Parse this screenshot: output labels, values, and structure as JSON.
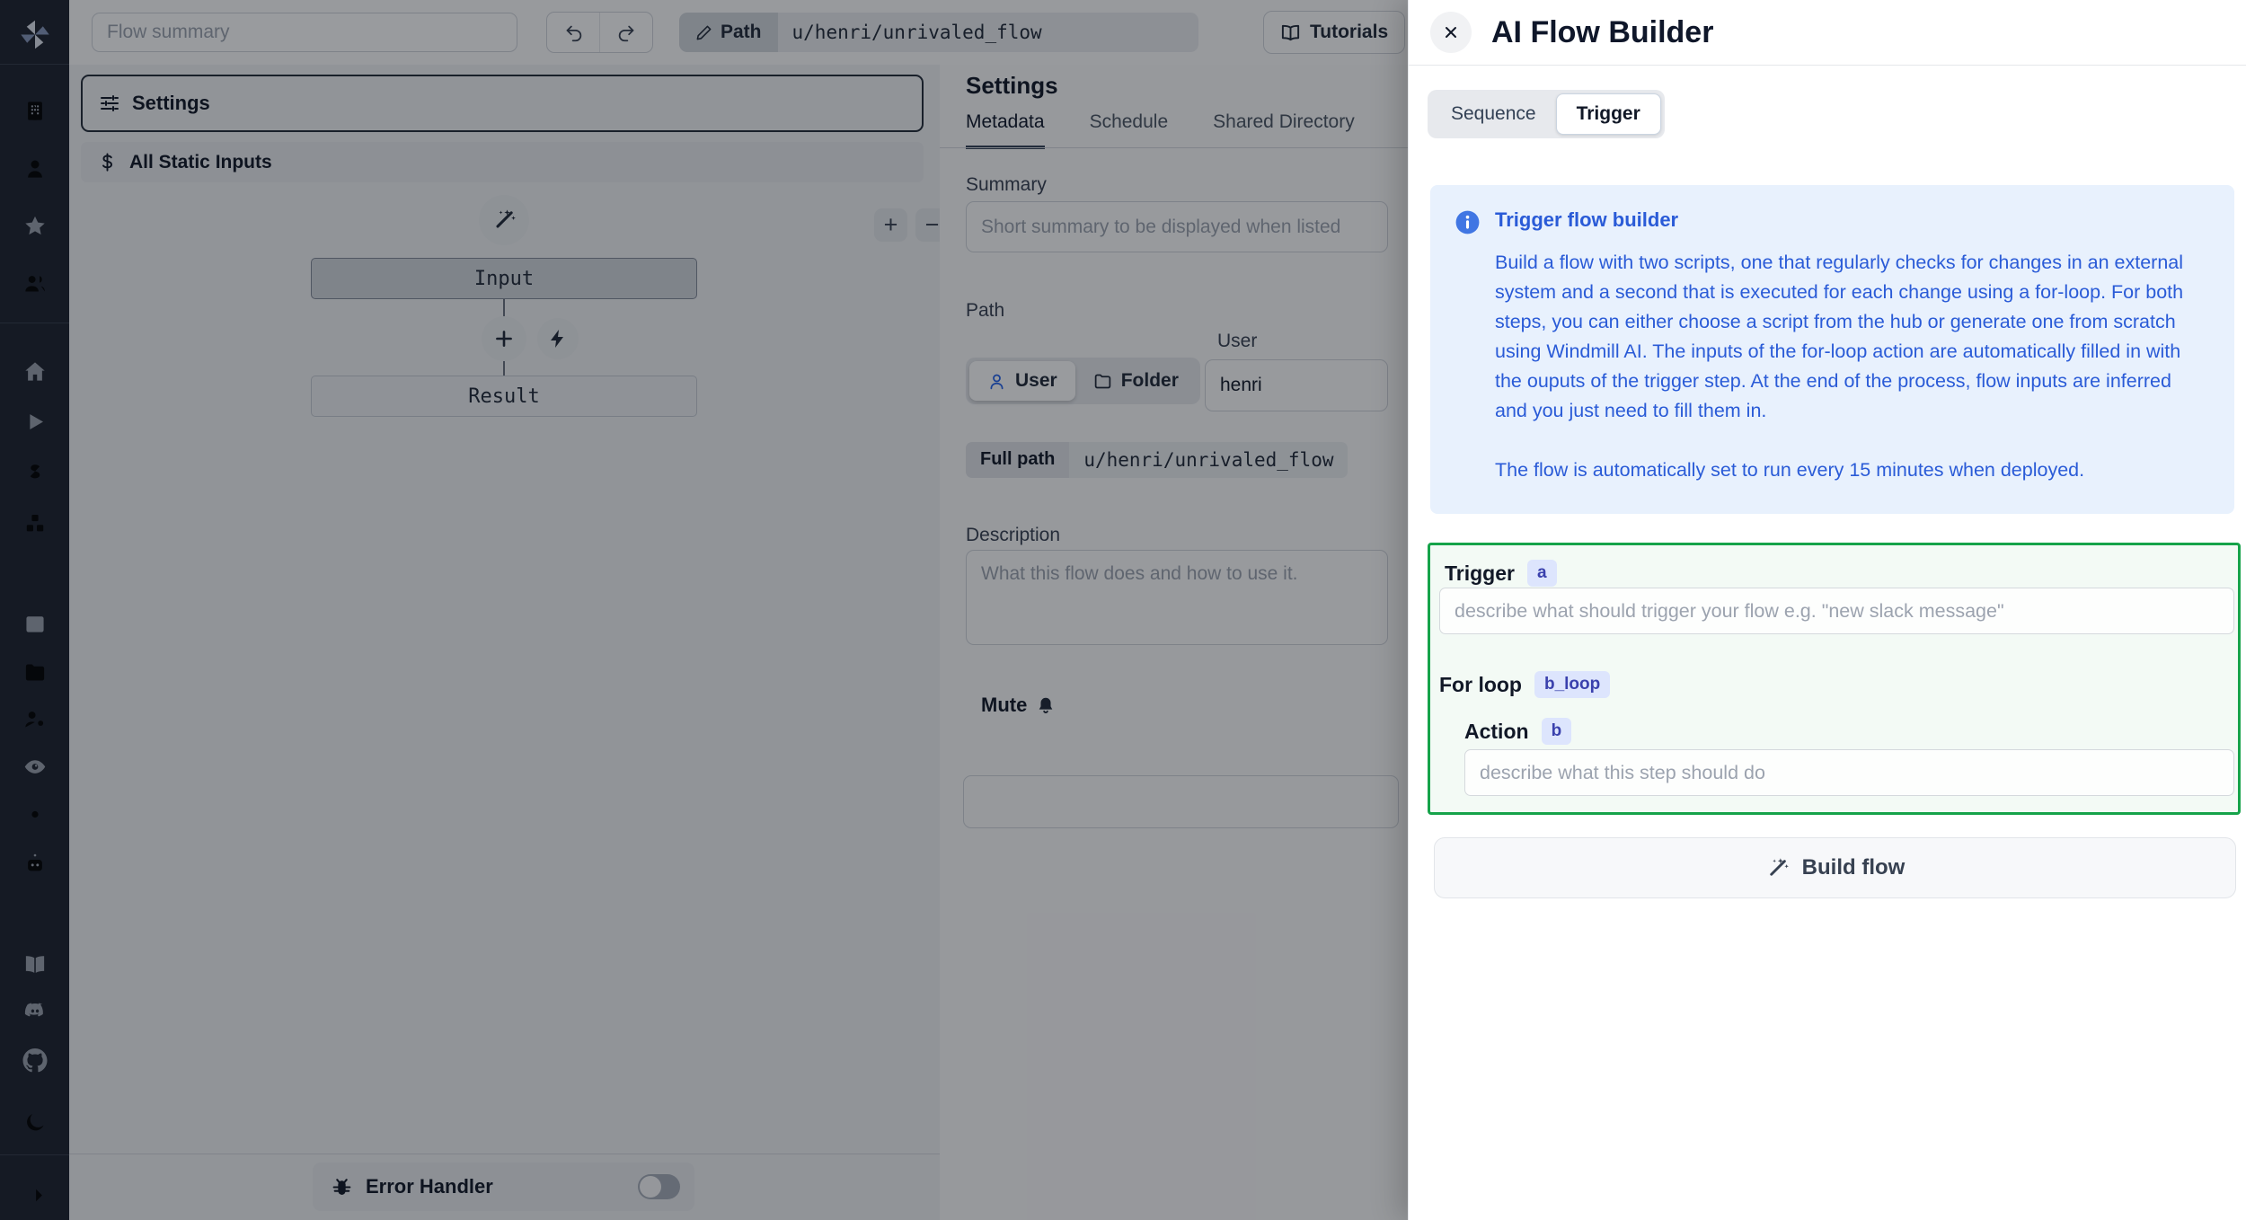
{
  "colors": {
    "accent_green": "#16a34a",
    "badge_bg": "#dde5fd",
    "badge_text": "#3a41ad",
    "info_blue": "#2a5bd7",
    "sidebar_bg": "#1d222d"
  },
  "sidebar": {
    "icons": [
      "windmill-logo",
      "building",
      "user",
      "star",
      "users",
      "home",
      "play",
      "dollar",
      "cubes",
      "calendar",
      "folder",
      "user-cog",
      "eye",
      "gear",
      "bot",
      "book",
      "discord",
      "github",
      "moon",
      "arrow-right"
    ]
  },
  "topbar": {
    "summary_placeholder": "Flow summary",
    "path_button": "Path",
    "path_value": "u/henri/unrivaled_flow",
    "tutorials": "Tutorials"
  },
  "flow_editor": {
    "settings_button": "Settings",
    "static_inputs_button": "All Static Inputs",
    "input_node": "Input",
    "result_node": "Result",
    "error_handler": "Error Handler",
    "zoom_in": "+",
    "zoom_out": "−"
  },
  "metadata_panel": {
    "title": "Settings",
    "tabs": {
      "metadata": "Metadata",
      "schedule": "Schedule",
      "shared_directory": "Shared Directory"
    },
    "summary": {
      "label": "Summary",
      "placeholder": "Short summary to be displayed when listed"
    },
    "path": {
      "label": "Path",
      "user_label": "User",
      "user_toggle": "User",
      "folder_toggle": "Folder",
      "user_value": "henri",
      "full_path_label": "Full path",
      "full_path_value": "u/henri/unrivaled_flow"
    },
    "description": {
      "label": "Description",
      "placeholder": "What this flow does and how to use it."
    },
    "mute_label": "Mute"
  },
  "ai_panel": {
    "title": "AI Flow Builder",
    "tabs": {
      "sequence": "Sequence",
      "trigger": "Trigger"
    },
    "info": {
      "title": "Trigger flow builder",
      "body": "Build a flow with two scripts, one that regularly checks for changes in an external system and a second that is executed for each change using a for-loop. For both steps, you can either choose a script from the hub or generate one from scratch using Windmill AI. The inputs of the for-loop action are automatically filled in with the ouputs of the trigger step. At the end of the process, flow inputs are inferred and you just need to fill them in.",
      "footer": "The flow is automatically set to run every 15 minutes when deployed."
    },
    "trigger": {
      "label": "Trigger",
      "badge": "a",
      "placeholder": "describe what should trigger your flow e.g. \"new slack message\""
    },
    "for_loop": {
      "label": "For loop",
      "badge": "b_loop"
    },
    "action": {
      "label": "Action",
      "badge": "b",
      "placeholder": "describe what this step should do"
    },
    "build_button": "Build flow"
  }
}
